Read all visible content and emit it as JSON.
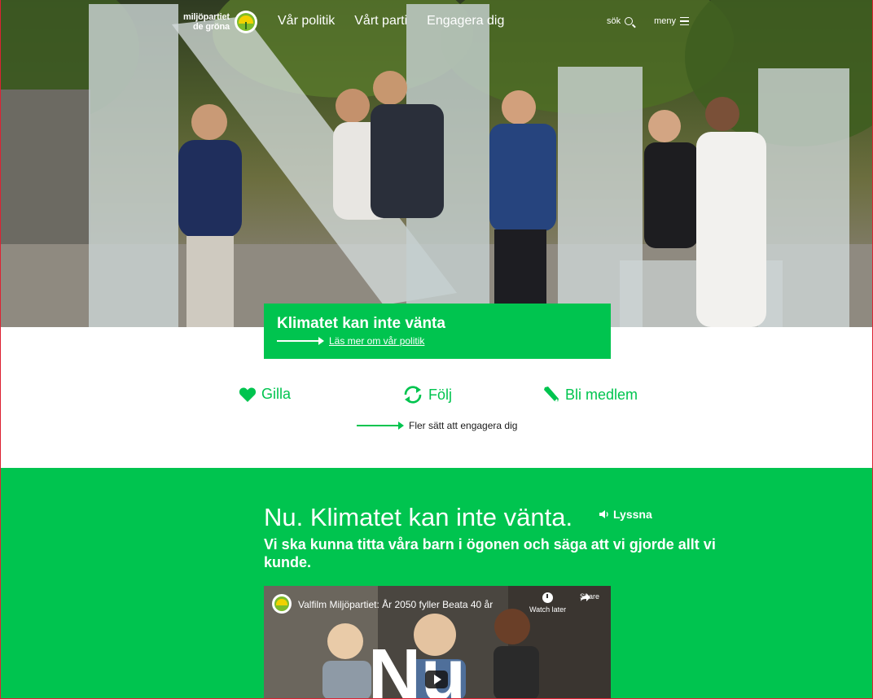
{
  "header": {
    "logo_line1": "miljöpartiet",
    "logo_line2": "de gröna",
    "nav": [
      "Vår politik",
      "Vårt parti",
      "Engagera dig"
    ],
    "search_label": "sök",
    "menu_label": "meny"
  },
  "hero": {
    "title": "Klimatet kan inte vänta",
    "link_label": "Läs mer om vår politik"
  },
  "engage": {
    "actions": [
      "Gilla",
      "Följ",
      "Bli medlem"
    ],
    "more_label": "Fler sätt att engagera dig"
  },
  "green_section": {
    "heading": "Nu. Klimatet kan inte vänta.",
    "listen_label": "Lyssna",
    "lead": "Vi ska kunna titta våra barn i ögonen och säga att vi gjorde allt vi kunde.",
    "video": {
      "title": "Valfilm Miljöpartiet: År 2050 fyller Beata 40 år",
      "watch_later": "Watch later",
      "share": "Share"
    }
  },
  "colors": {
    "brand_green": "#00c44f",
    "white": "#ffffff"
  }
}
